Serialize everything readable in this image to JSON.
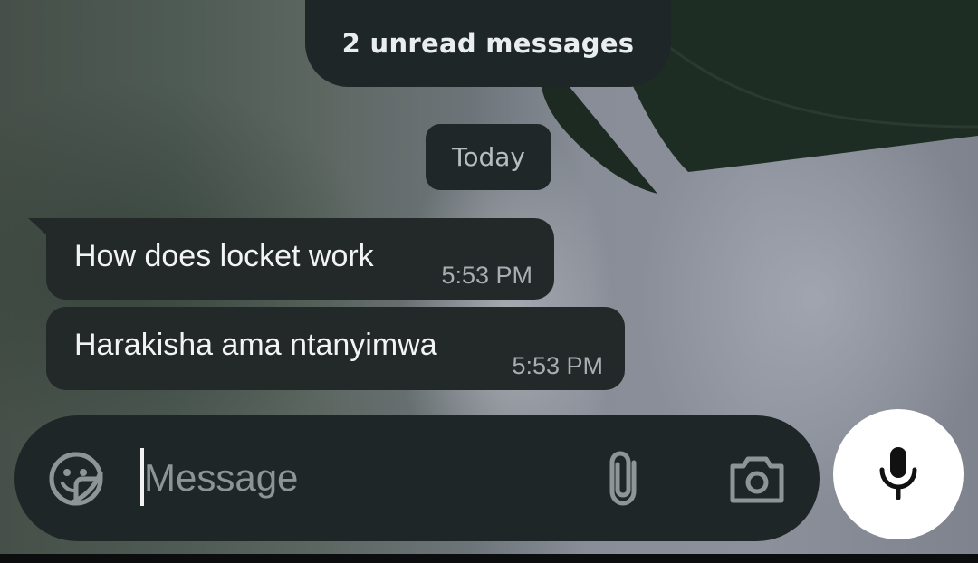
{
  "banner": {
    "unread": "2 unread messages"
  },
  "date_divider": "Today",
  "messages": [
    {
      "text": "How does locket work",
      "time": "5:53 PM"
    },
    {
      "text": "Harakisha ama ntanyimwa",
      "time": "5:53 PM"
    }
  ],
  "composer": {
    "placeholder": "Message",
    "value": ""
  },
  "icons": {
    "sticker": "sticker-icon",
    "attach": "paperclip-icon",
    "camera": "camera-icon",
    "mic": "microphone-icon"
  },
  "colors": {
    "bubble": "#232828",
    "composer": "#1f2627",
    "banner": "#1e2628",
    "mic_button": "#ffffff"
  }
}
